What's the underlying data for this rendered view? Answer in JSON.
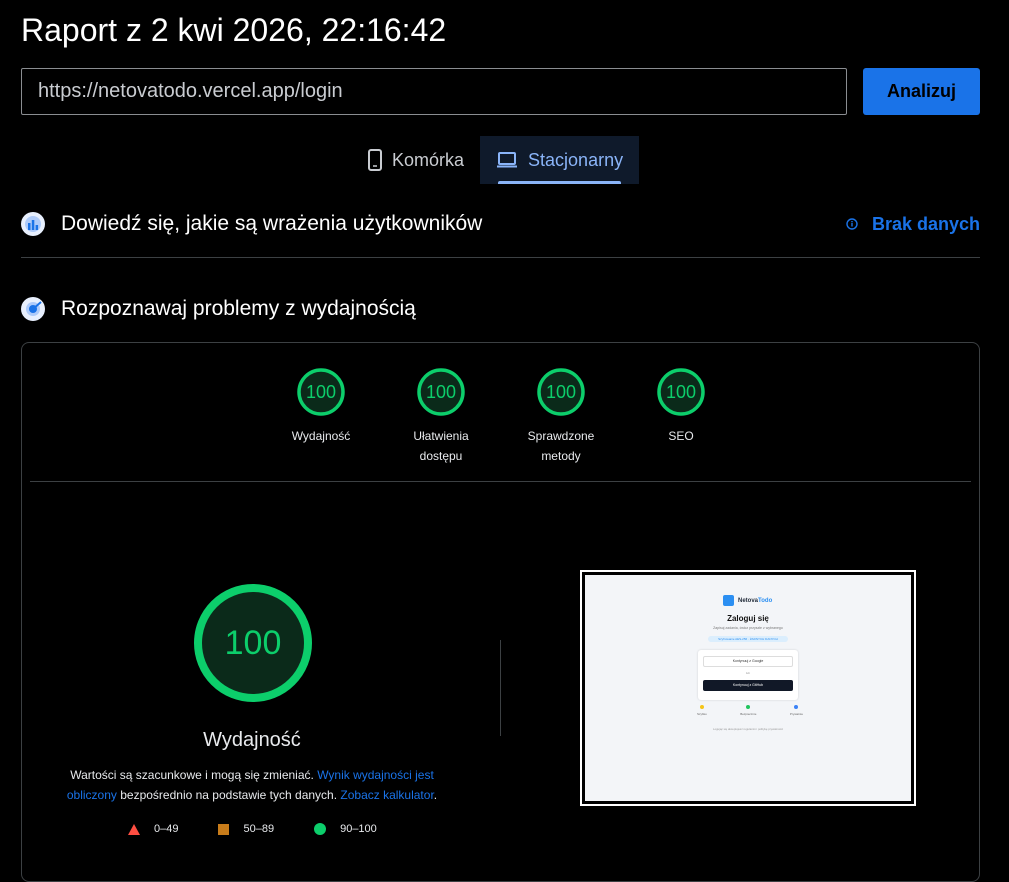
{
  "report": {
    "title": "Raport z 2 kwi 2026, 22:16:42"
  },
  "search": {
    "url_value": "https://netovatodo.vercel.app/login",
    "analyze_label": "Analizuj"
  },
  "tabs": [
    {
      "label": "Komórka",
      "icon": "smartphone-icon",
      "active": false
    },
    {
      "label": "Stacjonarny",
      "icon": "laptop-icon",
      "active": true
    }
  ],
  "field_data": {
    "heading": "Dowiedź się, jakie są wrażenia użytkowników",
    "status": "Brak danych",
    "icon": "users-experience-icon"
  },
  "lab_data": {
    "heading": "Rozpoznawaj problemy z wydajnością",
    "icon": "lighthouse-icon"
  },
  "categories": [
    {
      "label": "Wydajność",
      "score": "100"
    },
    {
      "label": "Ułatwienia dostępu",
      "score": "100"
    },
    {
      "label": "Sprawdzone metody",
      "score": "100"
    },
    {
      "label": "SEO",
      "score": "100"
    }
  ],
  "performance": {
    "score": "100",
    "label": "Wydajność",
    "note": {
      "part1": "Wartości są szacunkowe i mogą się zmieniać. ",
      "link1": "Wynik wydajności jest obliczony",
      "part2": " bezpośrednio na podstawie tych danych. ",
      "link2": "Zobacz kalkulator",
      "part3": "."
    }
  },
  "legend": [
    {
      "range": "0–49",
      "shape": "triangle",
      "color": "#ff4e42"
    },
    {
      "range": "50–89",
      "shape": "square",
      "color": "#c87c1a"
    },
    {
      "range": "90–100",
      "shape": "circle",
      "color": "#0cce6b"
    }
  ],
  "colors": {
    "pass": "#0cce6b",
    "accent": "#1a73e8",
    "tab_accent": "#8ab4f8"
  },
  "screenshot": {
    "brand_prefix": "Netova",
    "brand_suffix": "Todo",
    "title": "Zaloguj się",
    "subtitle": "Zapisuj zadania, ćwicz przyszłe z wybranego",
    "pill": "Szyfrowanie AES-256 · ŻADNYCH DANYCH",
    "google_button": "Kontynuuj z Google",
    "or": "lub",
    "github_button": "Kontynuuj z GitHub",
    "features": [
      "Szybko",
      "Bezpiecznie",
      "Prywatnie"
    ],
    "footer": "Logując się akceptujesz regulamin i politykę prywatności"
  }
}
